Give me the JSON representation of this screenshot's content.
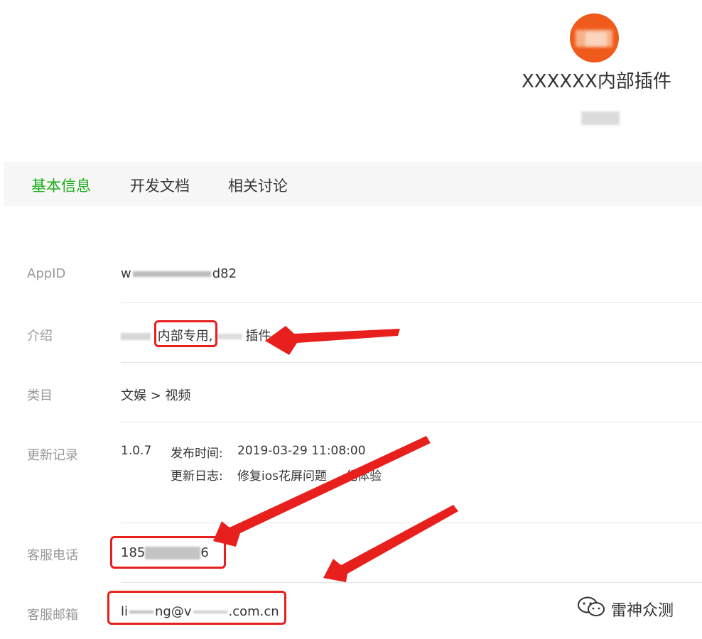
{
  "header": {
    "app_name": "XXXXXX内部插件"
  },
  "tabs": [
    {
      "label": "基本信息",
      "active": true
    },
    {
      "label": "开发文档",
      "active": false
    },
    {
      "label": "相关讨论",
      "active": false
    }
  ],
  "info": {
    "appid": {
      "label": "AppID",
      "value_start": "w",
      "value_end": "d82"
    },
    "intro": {
      "label": "介绍",
      "highlight": "内部专用",
      "separator": ",",
      "suffix": "插件"
    },
    "category": {
      "label": "类目",
      "value": "文娱 > 视频"
    },
    "changelog": {
      "label": "更新记录",
      "version": "1.0.7",
      "release_time_label": "发布时间:",
      "release_time": "2019-03-29 11:08:00",
      "log_label": "更新日志:",
      "log_start": "修复ios花屏问题",
      "log_end": "化体验"
    },
    "phone": {
      "label": "客服电话",
      "value_start": "185",
      "value_end": "6"
    },
    "email": {
      "label": "客服邮箱",
      "value_start": "li",
      "value_mid": "ng@v",
      "value_end": ".com.cn"
    }
  },
  "watermark": {
    "text": "雷神众测",
    "icon": "wechat-icon"
  },
  "colors": {
    "accent": "#1aad19",
    "highlight": "#e8201d",
    "logo": "#f05a1a"
  }
}
